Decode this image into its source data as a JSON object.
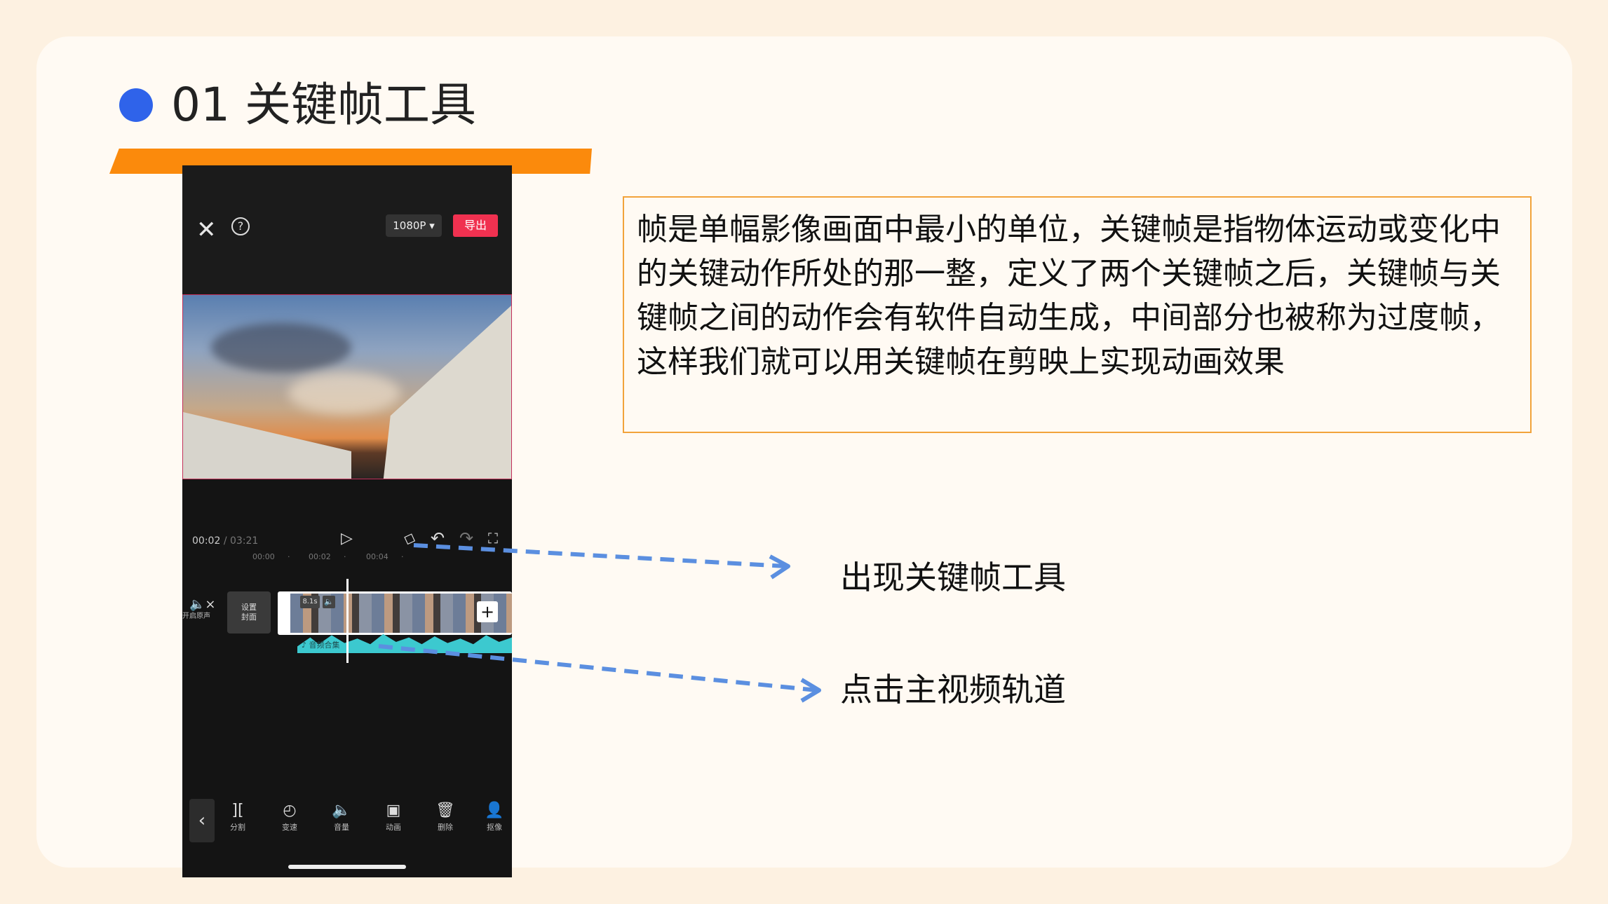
{
  "slide": {
    "title": "01 关键帧工具",
    "accent_blue": "#2f63ea",
    "accent_orange": "#fb8a0c"
  },
  "phone": {
    "top_bar": {
      "close_icon": "close-icon",
      "help_icon": "help-icon",
      "resolution_label": "1080P ▾",
      "export_label": "导出"
    },
    "player": {
      "current_time": "00:02",
      "separator": "/",
      "total_time": "03:21"
    },
    "ruler_marks": [
      "00:00",
      "·",
      "00:02",
      "·",
      "00:04",
      "·"
    ],
    "track": {
      "mute_label": "开启原声",
      "cover_label_line1": "设置",
      "cover_label_line2": "封面",
      "clip_duration": "8.1s",
      "audio_label": "♪ 音频合集"
    },
    "toolbar": [
      {
        "icon": "split-icon",
        "label": "分割"
      },
      {
        "icon": "speed-icon",
        "label": "变速"
      },
      {
        "icon": "volume-icon",
        "label": "音量"
      },
      {
        "icon": "animation-icon",
        "label": "动画"
      },
      {
        "icon": "delete-icon",
        "label": "删除"
      },
      {
        "icon": "cutout-icon",
        "label": "抠像"
      }
    ]
  },
  "description": "帧是单幅影像画面中最小的单位，关键帧是指物体运动或变化中的关键动作所处的那一整，定义了两个关键帧之后，关键帧与关键帧之间的动作会有软件自动生成，中间部分也被称为过度帧，这样我们就可以用关键帧在剪映上实现动画效果",
  "callouts": {
    "keyframe_tool": "出现关键帧工具",
    "main_track": "点击主视频轨道"
  }
}
